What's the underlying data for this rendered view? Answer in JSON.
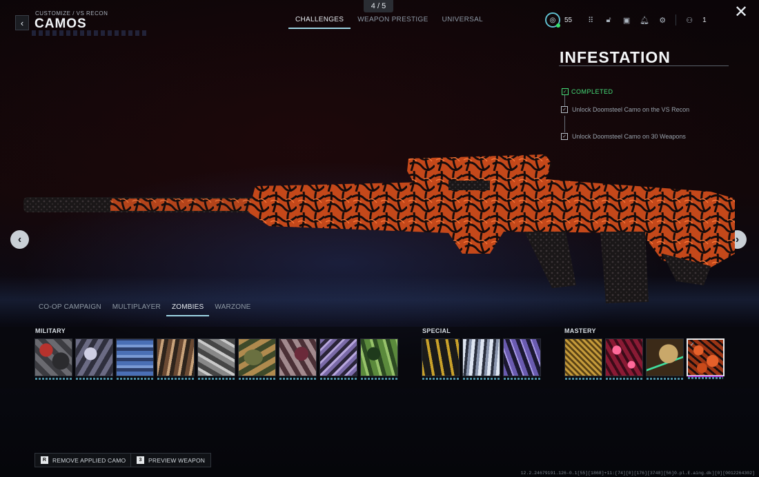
{
  "header": {
    "breadcrumb": "CUSTOMIZE / VS RECON",
    "title": "CAMOS",
    "page_indicator": "4 / 5"
  },
  "top_tabs": [
    {
      "label": "CHALLENGES",
      "active": true
    },
    {
      "label": "WEAPON PRESTIGE",
      "active": false
    },
    {
      "label": "UNIVERSAL",
      "active": false
    }
  ],
  "hud": {
    "level": "55",
    "party_count": "1",
    "icons": [
      "grid-icon",
      "lock-icon",
      "camera-icon",
      "bell-icon",
      "gear-icon",
      "party-icon"
    ]
  },
  "challenge": {
    "camo_name": "INFESTATION",
    "status": "COMPLETED",
    "items": [
      "Unlock Doomsteel Camo on the VS Recon",
      "Unlock Doomsteel Camo on 30 Weapons"
    ]
  },
  "mode_tabs": [
    {
      "label": "CO-OP CAMPAIGN",
      "active": false
    },
    {
      "label": "MULTIPLAYER",
      "active": false
    },
    {
      "label": "ZOMBIES",
      "active": true
    },
    {
      "label": "WARZONE",
      "active": false
    }
  ],
  "categories": {
    "military": "MILITARY",
    "special": "SPECIAL",
    "mastery": "MASTERY"
  },
  "bottom": {
    "remove_key": "R",
    "remove_label": "REMOVE APPLIED CAMO",
    "preview_key": "3",
    "preview_label": "PREVIEW WEAPON"
  },
  "build_info": "12.2.24679191.126-0.1[55][1868]+11:[74][0][176][3748][56]0.pl.E.aing.dk][0][0012264302]",
  "colors": {
    "accent": "#9fd7e6",
    "completed": "#46e07a",
    "camo_orange": "#d7521c",
    "selected_bar": "#b04ae0"
  }
}
